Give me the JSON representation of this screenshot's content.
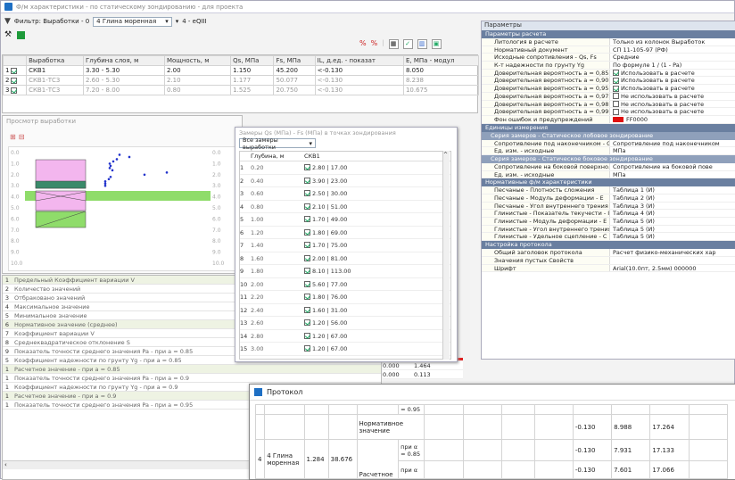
{
  "window": {
    "title": "Ф/м характеристики - по статическому зондированию - для проекта"
  },
  "toolbar": {
    "filter_label": "Фильтр: Выработки - 0",
    "layer_select": "4 Глина моренная",
    "layer_code": "4 - eQIII"
  },
  "main_table": {
    "headers": [
      "",
      "Выработка",
      "Глубина слоя, м",
      "Мощность, м",
      "Qs, МПа",
      "Fs, МПа",
      "IL, д.ед. - показат",
      "E, МПа - модул"
    ],
    "rows": [
      {
        "n": "1",
        "well": "СКВ1",
        "depth": "3.30 - 5.30",
        "thick": "2.00",
        "qs": "1.150",
        "fs": "45.200",
        "il": "<-0.130",
        "e": "8.050",
        "gray": false
      },
      {
        "n": "2",
        "well": "СКВ1-ТС3",
        "depth": "2.60 - 5.30",
        "thick": "2.10",
        "qs": "1.177",
        "fs": "50.077",
        "il": "<-0.130",
        "e": "8.238",
        "gray": true
      },
      {
        "n": "3",
        "well": "СКВ1-ТС3",
        "depth": "7.20 - 8.00",
        "thick": "0.80",
        "qs": "1.525",
        "fs": "20.750",
        "il": "<-0.130",
        "e": "10.675",
        "gray": true
      }
    ]
  },
  "preview": {
    "title": "Просмотр выработки",
    "depth_labels": [
      "0.0",
      "1.0",
      "2.0",
      "3.0",
      "4.0",
      "5.0",
      "6.0",
      "7.0",
      "8.0",
      "9.0",
      "10.0"
    ],
    "colors": {
      "pink": "#f3b6ee",
      "green": "#8fdc6a",
      "teal": "#3a8a6a",
      "blue": "#2233cc"
    }
  },
  "measurements": {
    "title": "Замеры Qs (МПа) - Fs (МПа) в точках зондирования",
    "filter": "Все замеры выработки",
    "col_depth": "Глубина, м",
    "col_well": "СКВ1",
    "rows": [
      {
        "n": "1",
        "d": "0.20",
        "v": "2.80 | 17.00"
      },
      {
        "n": "2",
        "d": "0.40",
        "v": "3.90 | 23.00"
      },
      {
        "n": "3",
        "d": "0.60",
        "v": "2.50 | 30.00"
      },
      {
        "n": "4",
        "d": "0.80",
        "v": "2.10 | 51.00"
      },
      {
        "n": "5",
        "d": "1.00",
        "v": "1.70 | 49.00"
      },
      {
        "n": "6",
        "d": "1.20",
        "v": "1.80 | 69.00"
      },
      {
        "n": "7",
        "d": "1.40",
        "v": "1.70 | 75.00"
      },
      {
        "n": "8",
        "d": "1.60",
        "v": "2.00 | 81.00"
      },
      {
        "n": "9",
        "d": "1.80",
        "v": "8.10 | 113.00"
      },
      {
        "n": "10",
        "d": "2.00",
        "v": "5.60 | 77.00"
      },
      {
        "n": "11",
        "d": "2.20",
        "v": "1.80 | 76.00"
      },
      {
        "n": "12",
        "d": "2.40",
        "v": "1.60 | 31.00"
      },
      {
        "n": "13",
        "d": "2.60",
        "v": "1.20 | 56.00"
      },
      {
        "n": "14",
        "d": "2.80",
        "v": "1.20 | 67.00"
      },
      {
        "n": "15",
        "d": "3.00",
        "v": "1.20 | 67.00"
      }
    ]
  },
  "stats": {
    "rows": [
      {
        "n": "1",
        "label": "Предельный Коэффициент вариации V",
        "hl": true
      },
      {
        "n": "2",
        "label": "Количество значений",
        "hl": false
      },
      {
        "n": "3",
        "label": "Отбраковано значений",
        "hl": false
      },
      {
        "n": "4",
        "label": "Максимальное значение",
        "hl": false
      },
      {
        "n": "5",
        "label": "Минимальное значение",
        "hl": false
      },
      {
        "n": "6",
        "label": "Нормативное значение (среднее)",
        "hl": true
      },
      {
        "n": "7",
        "label": "Коэффициент вариации V",
        "hl": false
      },
      {
        "n": "8",
        "label": "Среднеквадратическое отклонение S",
        "hl": false
      },
      {
        "n": "9",
        "label": "Показатель точности среднего значения Pa - при a = 0.85",
        "hl": false
      },
      {
        "n": "5",
        "label": "Коэффициент надежности по грунту Yg - при a = 0.85",
        "hl": false
      },
      {
        "n": "1",
        "label": "Расчетное значение - при a = 0.85",
        "hl": true
      },
      {
        "n": "1",
        "label": "Показатель точности среднего значения Pa - при a = 0.9",
        "hl": false
      },
      {
        "n": "1",
        "label": "Коэффициент надежности по грунту Yg - при a = 0.9",
        "hl": false
      },
      {
        "n": "1",
        "label": "Расчетное значение - при a = 0.9",
        "hl": true
      },
      {
        "n": "1",
        "label": "Показатель точности среднего значения Pa - при a = 0.95",
        "hl": false
      }
    ],
    "side_values": [
      {
        "a": "0.000",
        "b": "1.464"
      },
      {
        "a": "0.000",
        "b": "0.113"
      }
    ]
  },
  "props": {
    "title": "Параметры",
    "sections": [
      {
        "name": "Параметры расчета",
        "type": "sec"
      },
      {
        "k": "Литология в расчете",
        "v": "Только из колонок Выработок"
      },
      {
        "k": "Нормативный документ",
        "v": "СП 11-105-97 (РФ)"
      },
      {
        "k": "Исходные сопротивления - Qs, Fs",
        "v": "Средние"
      },
      {
        "k": "К-т надежности по грунту Yg",
        "v": "По формуле 1 / (1 - Pa)"
      },
      {
        "k": "Доверительная вероятность a = 0,85",
        "v": "Использовать в расчете",
        "chk": true
      },
      {
        "k": "Доверительная вероятность a = 0,90",
        "v": "Использовать в расчете",
        "chk": true
      },
      {
        "k": "Доверительная вероятность a = 0,95",
        "v": "Использовать в расчете",
        "chk": true
      },
      {
        "k": "Доверительная вероятность a = 0,975",
        "v": "Не использовать в расчете",
        "chk": false
      },
      {
        "k": "Доверительная вероятность a = 0,98",
        "v": "Не использовать в расчете",
        "chk": false
      },
      {
        "k": "Доверительная вероятность a = 0,99",
        "v": "Не использовать в расчете",
        "chk": false
      },
      {
        "k": "Фон ошибок и предупреждений",
        "v": "FF0000",
        "color": "#e01010"
      },
      {
        "name": "Единицы измерения",
        "type": "sec"
      },
      {
        "name": "Серия замеров - Статическое лобовое зондирование",
        "type": "sub"
      },
      {
        "k": "Сопротивление под наконечником - Qs",
        "v": "Сопротивление под наконечником"
      },
      {
        "k": "Ед. изм. - исходные",
        "v": "МПа"
      },
      {
        "name": "Серия замеров - Статическое боковое зондирование",
        "type": "sub"
      },
      {
        "k": "Сопротивление на боковой поверхно...",
        "v": "Сопротивление на боковой пове"
      },
      {
        "k": "Ед. изм. - исходные",
        "v": "МПа"
      },
      {
        "name": "Нормативные ф/м характеристики",
        "type": "sec"
      },
      {
        "k": "Песчаные - Плотность сложения",
        "v": "Таблица 1 (И)"
      },
      {
        "k": "Песчаные - Модуль деформации - E",
        "v": "Таблица 2 (И)"
      },
      {
        "k": "Песчаные - Угол внутреннего трения - Ф",
        "v": "Таблица 3 (И)"
      },
      {
        "k": "Глинистые - Показатель текучести - IL",
        "v": "Таблица 4 (И)"
      },
      {
        "k": "Глинистые - Модуль деформации - E",
        "v": "Таблица 5 (И)"
      },
      {
        "k": "Глинистые - Угол внутреннего трения - Ф",
        "v": "Таблица 5 (И)"
      },
      {
        "k": "Глинистые - Удельное сцепление - C",
        "v": "Таблица 5 (И)"
      },
      {
        "name": "Настройка протокола",
        "type": "sec"
      },
      {
        "k": "Общий заголовок протокола",
        "v": "Расчет физико-механических хар"
      },
      {
        "k": "Значения пустых Свойств",
        "v": ""
      },
      {
        "k": "Шрифт",
        "v": "Arial(10.0пт, 2.5мм) 000000"
      }
    ]
  },
  "protocol": {
    "title": "Протокол",
    "layer": "4 Глина моренная",
    "thick": "1.284",
    "num": "38.676",
    "row_label_norm": "Нормативное значение",
    "row_label_calc": "Расчетное",
    "alpha_085": "при α = 0.85",
    "alpha_09": "при α",
    "alpha_top": "= 0.95",
    "row_num": "4",
    "vals": [
      {
        "a": "-0.130",
        "b": "8.988",
        "c": "17.264"
      },
      {
        "a": "-0.130",
        "b": "7.931",
        "c": "17.133"
      },
      {
        "a": "-0.130",
        "b": "7.601",
        "c": "17.066"
      }
    ]
  }
}
